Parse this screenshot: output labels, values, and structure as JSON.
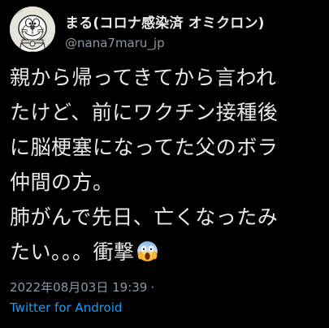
{
  "tweet": {
    "author": {
      "display_name": "まる(コロナ感染済 オミクロン)",
      "handle": "@nana7maru_jp",
      "avatar_icon": "cartoon-robot-avatar-icon"
    },
    "text_lines": [
      "親から帰ってきてから言われ",
      "たけど、前にワクチン接種後",
      "に脳梗塞になってた父のボラ",
      "仲間の方。",
      "肺がんで先日、亡くなったみ",
      "たい。。。衝撃"
    ],
    "emoji": "face-screaming-in-fear-emoji",
    "timestamp": "2022年08月03日 19:39",
    "separator": "·",
    "source": "Twitter for Android"
  },
  "colors": {
    "background": "#000000",
    "text_primary": "#e7e9ea",
    "text_secondary": "#8b98a5",
    "link": "#1d9bf0"
  }
}
